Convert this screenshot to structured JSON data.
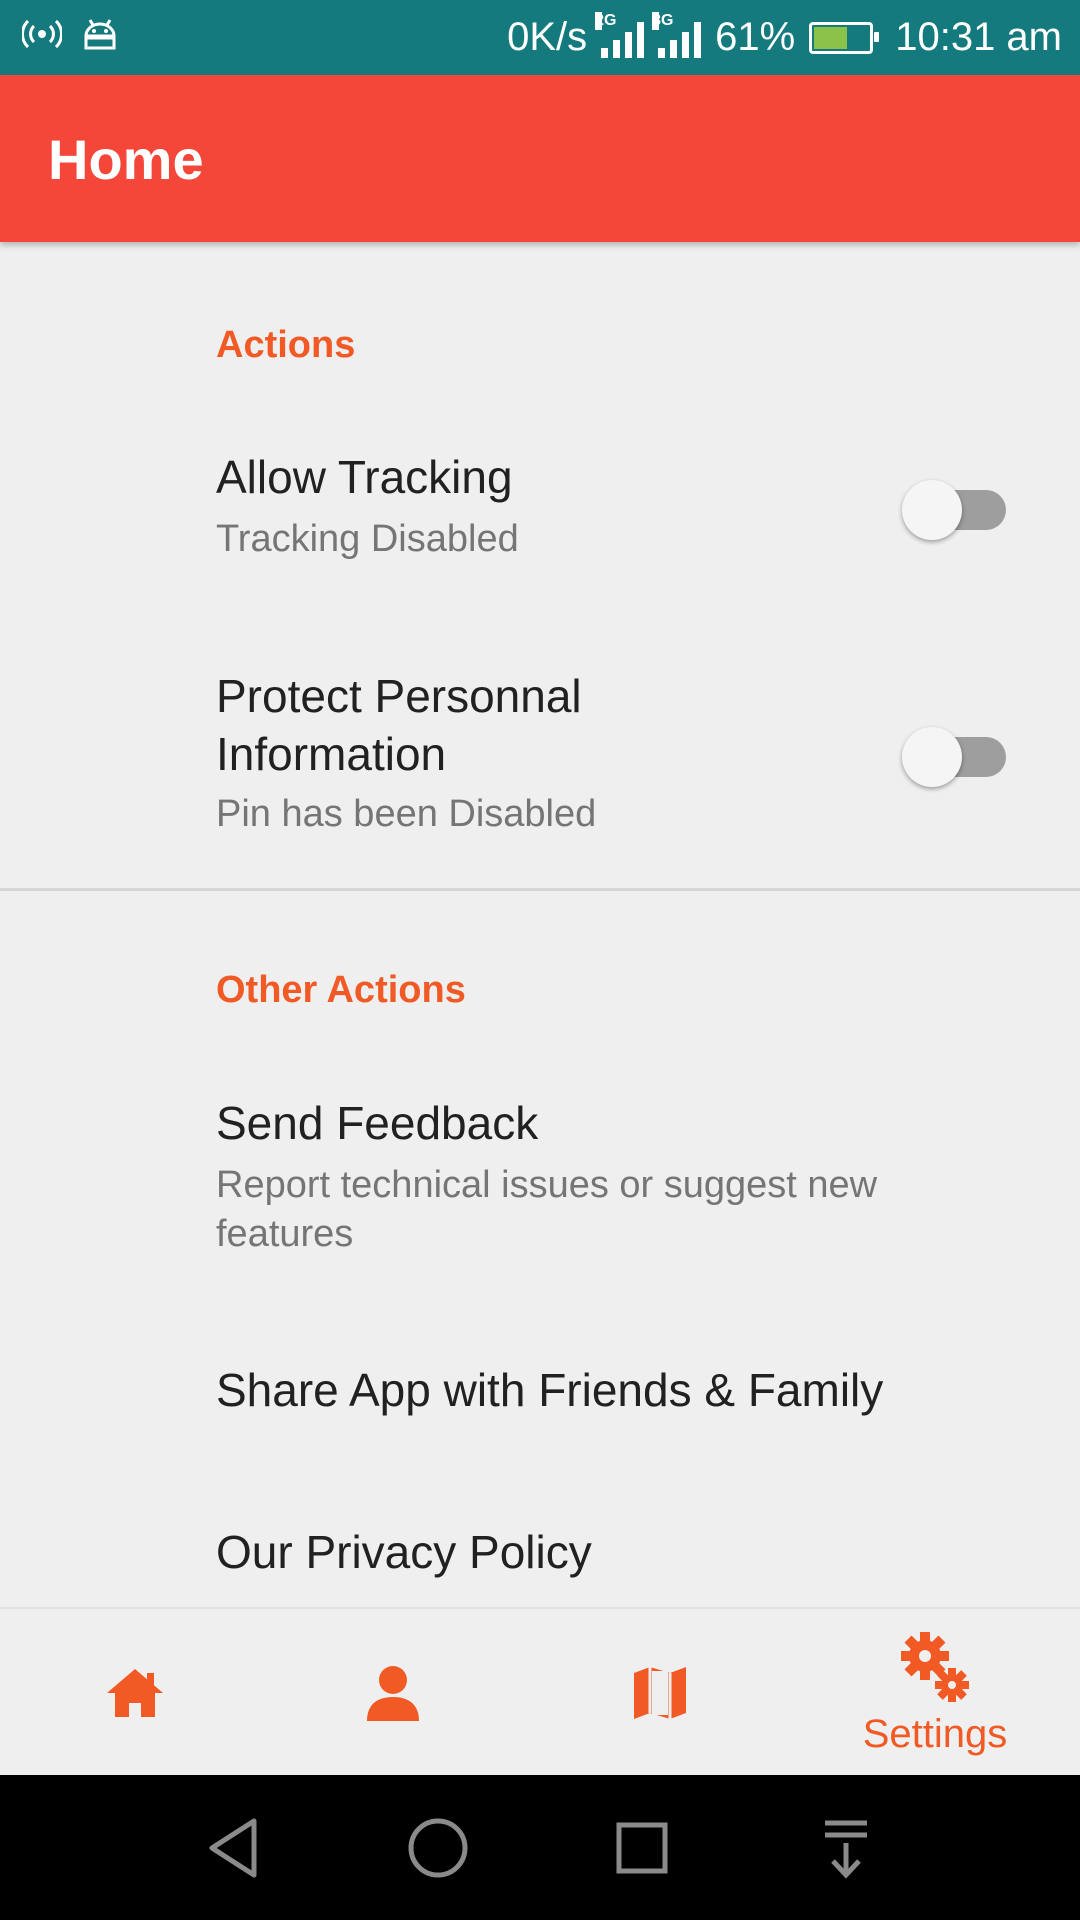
{
  "status_bar": {
    "net_speed": "0K/s",
    "signal1_tag": "2G",
    "signal2_tag": "3G",
    "battery_percent": "61%",
    "battery_level": 0.61,
    "time": "10:31 am",
    "icons": [
      "hotspot-icon",
      "android-debug-icon",
      "signal-2g-icon",
      "signal-3g-icon",
      "battery-charging-icon"
    ]
  },
  "app_bar": {
    "title": "Home"
  },
  "sections": {
    "actions": {
      "title": "Actions",
      "tracking": {
        "title": "Allow Tracking",
        "subtitle": "Tracking Disabled",
        "enabled": false
      },
      "protect": {
        "title_line1": "Protect Personnal",
        "title_line2": "Information",
        "subtitle": "Pin has been Disabled",
        "enabled": false
      }
    },
    "other": {
      "title": "Other Actions",
      "feedback": {
        "title": "Send Feedback",
        "subtitle_line1": "Report technical issues or suggest new",
        "subtitle_line2": "features"
      },
      "share": {
        "title": "Share App with Friends & Family"
      },
      "privacy": {
        "title": "Our Privacy Policy"
      }
    }
  },
  "bottom_nav": {
    "items": [
      {
        "icon": "home-icon",
        "label": ""
      },
      {
        "icon": "person-icon",
        "label": ""
      },
      {
        "icon": "map-icon",
        "label": ""
      },
      {
        "icon": "settings-icon",
        "label": "Settings",
        "selected": true
      }
    ]
  },
  "colors": {
    "status_bar": "#157a7e",
    "app_bar": "#f4473a",
    "accent": "#f15a24",
    "background": "#efefef"
  }
}
